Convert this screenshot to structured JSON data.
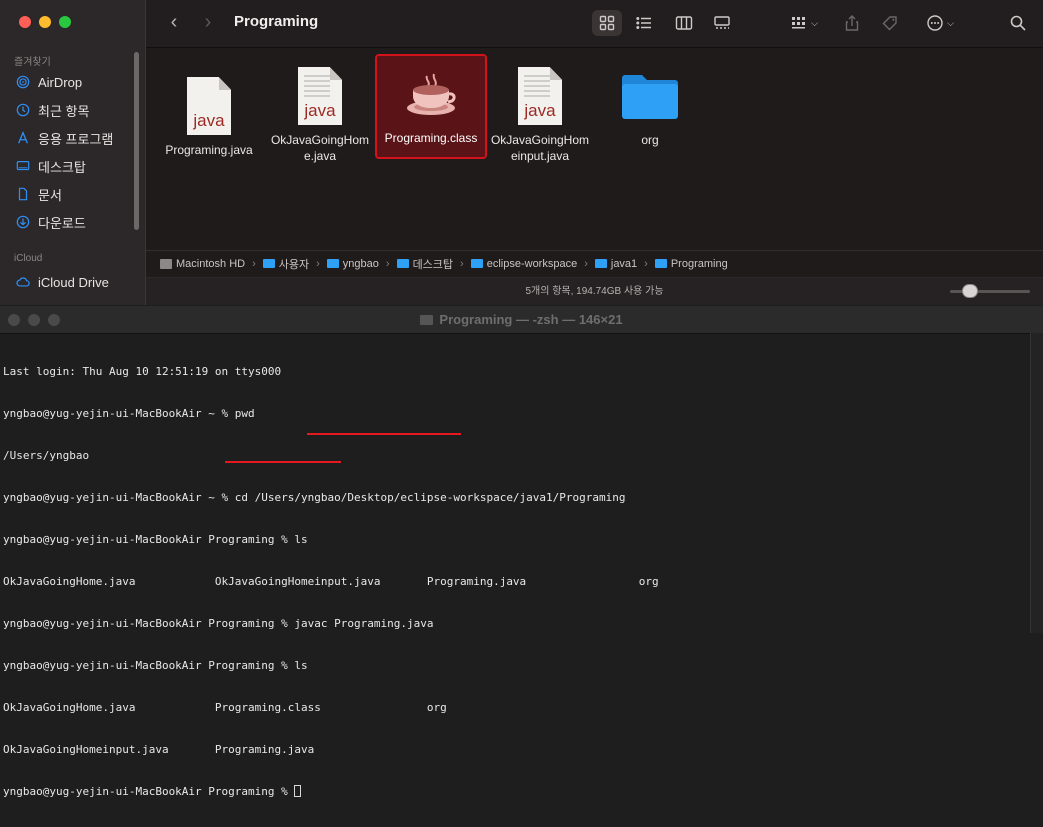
{
  "finder": {
    "sidebar": {
      "favorites_header": "즐겨찾기",
      "items": [
        {
          "label": "AirDrop",
          "icon": "airdrop-icon"
        },
        {
          "label": "최근 항목",
          "icon": "clock-icon"
        },
        {
          "label": "응용 프로그램",
          "icon": "apps-icon"
        },
        {
          "label": "데스크탑",
          "icon": "desktop-icon"
        },
        {
          "label": "문서",
          "icon": "document-icon"
        },
        {
          "label": "다운로드",
          "icon": "download-icon"
        }
      ],
      "icloud_header": "iCloud",
      "icloud_items": [
        {
          "label": "iCloud Drive",
          "icon": "cloud-icon"
        }
      ]
    },
    "toolbar": {
      "back": "‹",
      "forward": "›",
      "title": "Programing"
    },
    "files": [
      {
        "name": "Programing.java",
        "kind": "java"
      },
      {
        "name": "OkJavaGoingHome.java",
        "kind": "java-doc"
      },
      {
        "name": "Programing.class",
        "kind": "class",
        "selected": true
      },
      {
        "name": "OkJavaGoingHomeinput.java",
        "kind": "java-doc"
      },
      {
        "name": "org",
        "kind": "folder"
      }
    ],
    "file_labels": {
      "f0": "Programing.java",
      "f1a": "OkJavaGoingHom",
      "f1b": "e.java",
      "f2": "Programing.class",
      "f3a": "OkJavaGoingHom",
      "f3b": "einput.java",
      "f4": "org",
      "java_text": "java"
    },
    "path": [
      "Macintosh HD",
      "사용자",
      "yngbao",
      "데스크탑",
      "eclipse-workspace",
      "java1",
      "Programing"
    ],
    "status": "5개의 항목, 194.74GB 사용 가능",
    "colors": {
      "selection": "#d3121b",
      "folder": "#2ea0f5"
    }
  },
  "terminal": {
    "title": "Programing — -zsh — 146×21",
    "lines": [
      "Last login: Thu Aug 10 12:51:19 on ttys000",
      "yngbao@yug-yejin-ui-MacBookAir ~ % pwd",
      "/Users/yngbao",
      "yngbao@yug-yejin-ui-MacBookAir ~ % cd /Users/yngbao/Desktop/eclipse-workspace/java1/Programing",
      "yngbao@yug-yejin-ui-MacBookAir Programing % ls",
      "OkJavaGoingHome.java            OkJavaGoingHomeinput.java       Programing.java                 org",
      "yngbao@yug-yejin-ui-MacBookAir Programing % javac Programing.java",
      "yngbao@yug-yejin-ui-MacBookAir Programing % ls",
      "OkJavaGoingHome.java            Programing.class                org",
      "OkJavaGoingHomeinput.java       Programing.java",
      "yngbao@yug-yejin-ui-MacBookAir Programing % "
    ],
    "highlight_color": "#e4181f"
  }
}
